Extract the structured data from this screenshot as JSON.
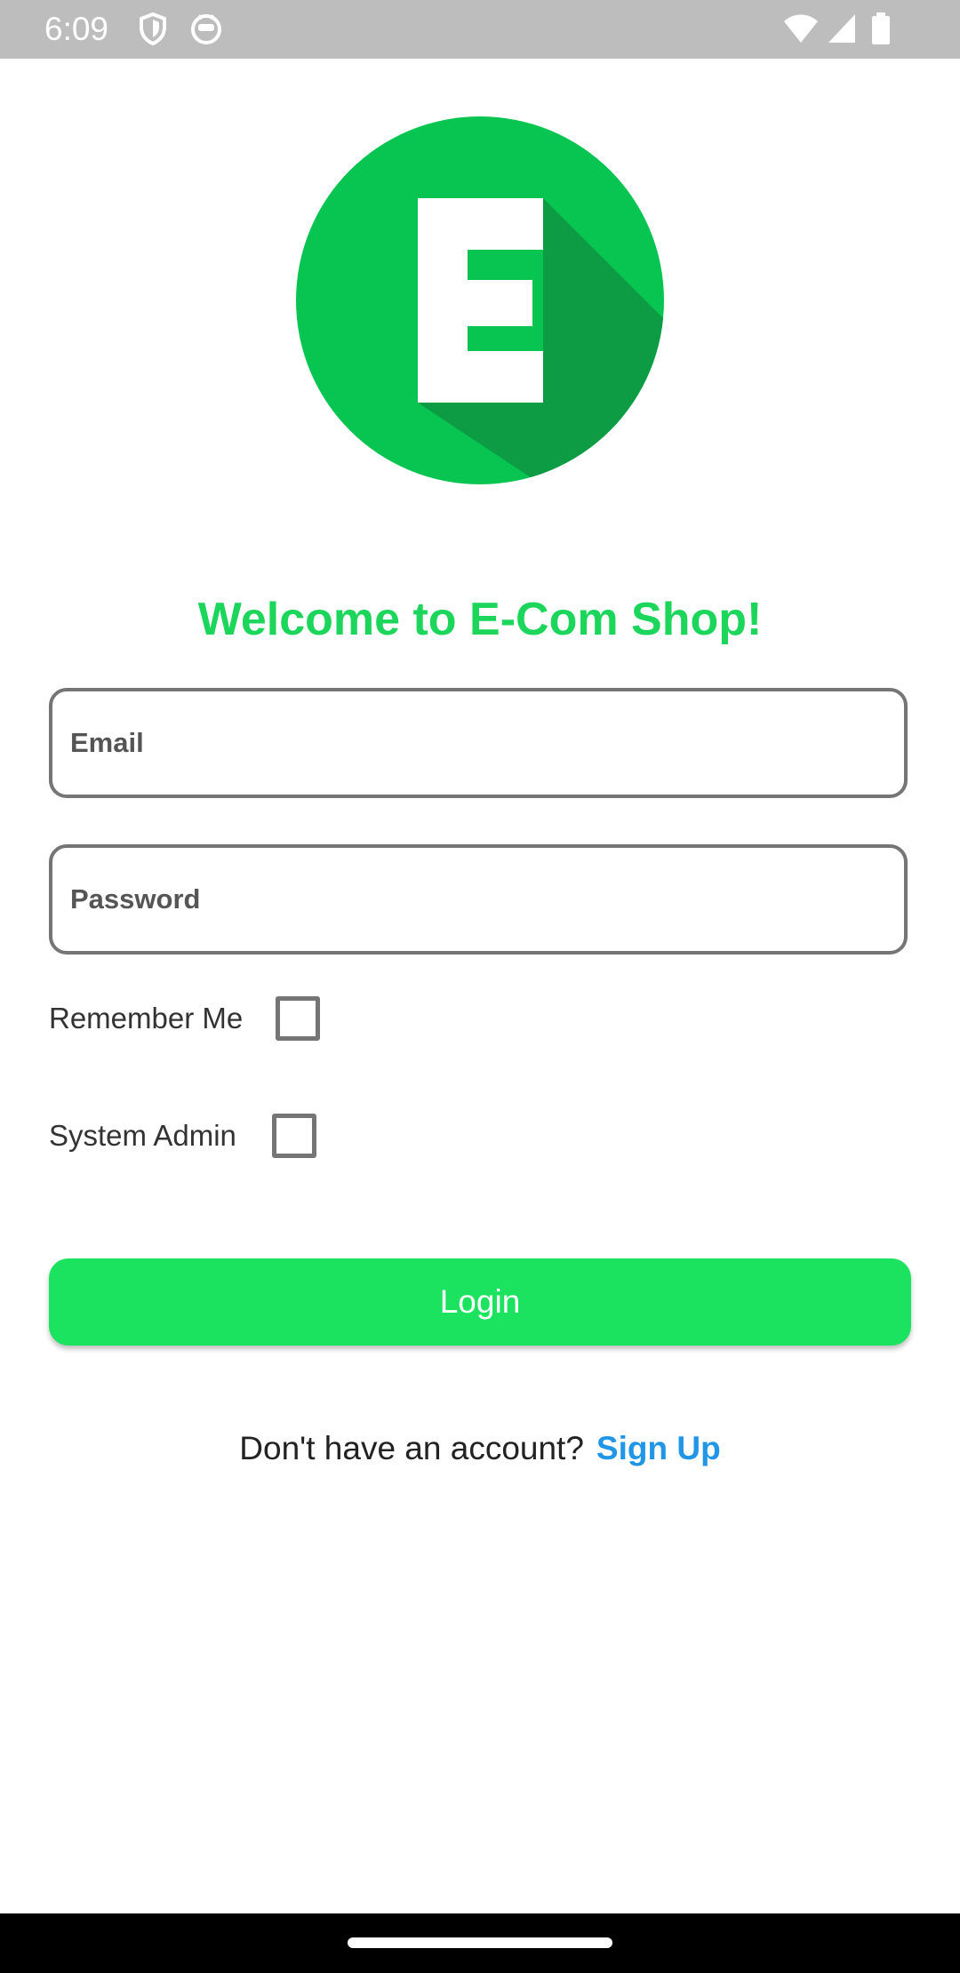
{
  "status_bar": {
    "time": "6:09",
    "left_icons": [
      "shield-icon",
      "cat-face-icon"
    ],
    "right_icons": [
      "wifi-icon",
      "cell-signal-icon",
      "battery-icon"
    ]
  },
  "logo": {
    "letter": "E",
    "circle_color": "#08c552",
    "shadow_color": "#0d9b43"
  },
  "title": "Welcome to E-Com Shop!",
  "email_field": {
    "label": "Email",
    "value": ""
  },
  "password_field": {
    "label": "Password",
    "value": ""
  },
  "remember_me": {
    "label": "Remember Me",
    "checked": false
  },
  "system_admin": {
    "label": "System Admin",
    "checked": false
  },
  "login_button": {
    "label": "Login"
  },
  "signup": {
    "prompt": "Don't have an account?",
    "link": "Sign Up"
  },
  "colors": {
    "accent_green": "#1ce35f",
    "title_green": "#1cd65c",
    "link_blue": "#2196e6"
  }
}
